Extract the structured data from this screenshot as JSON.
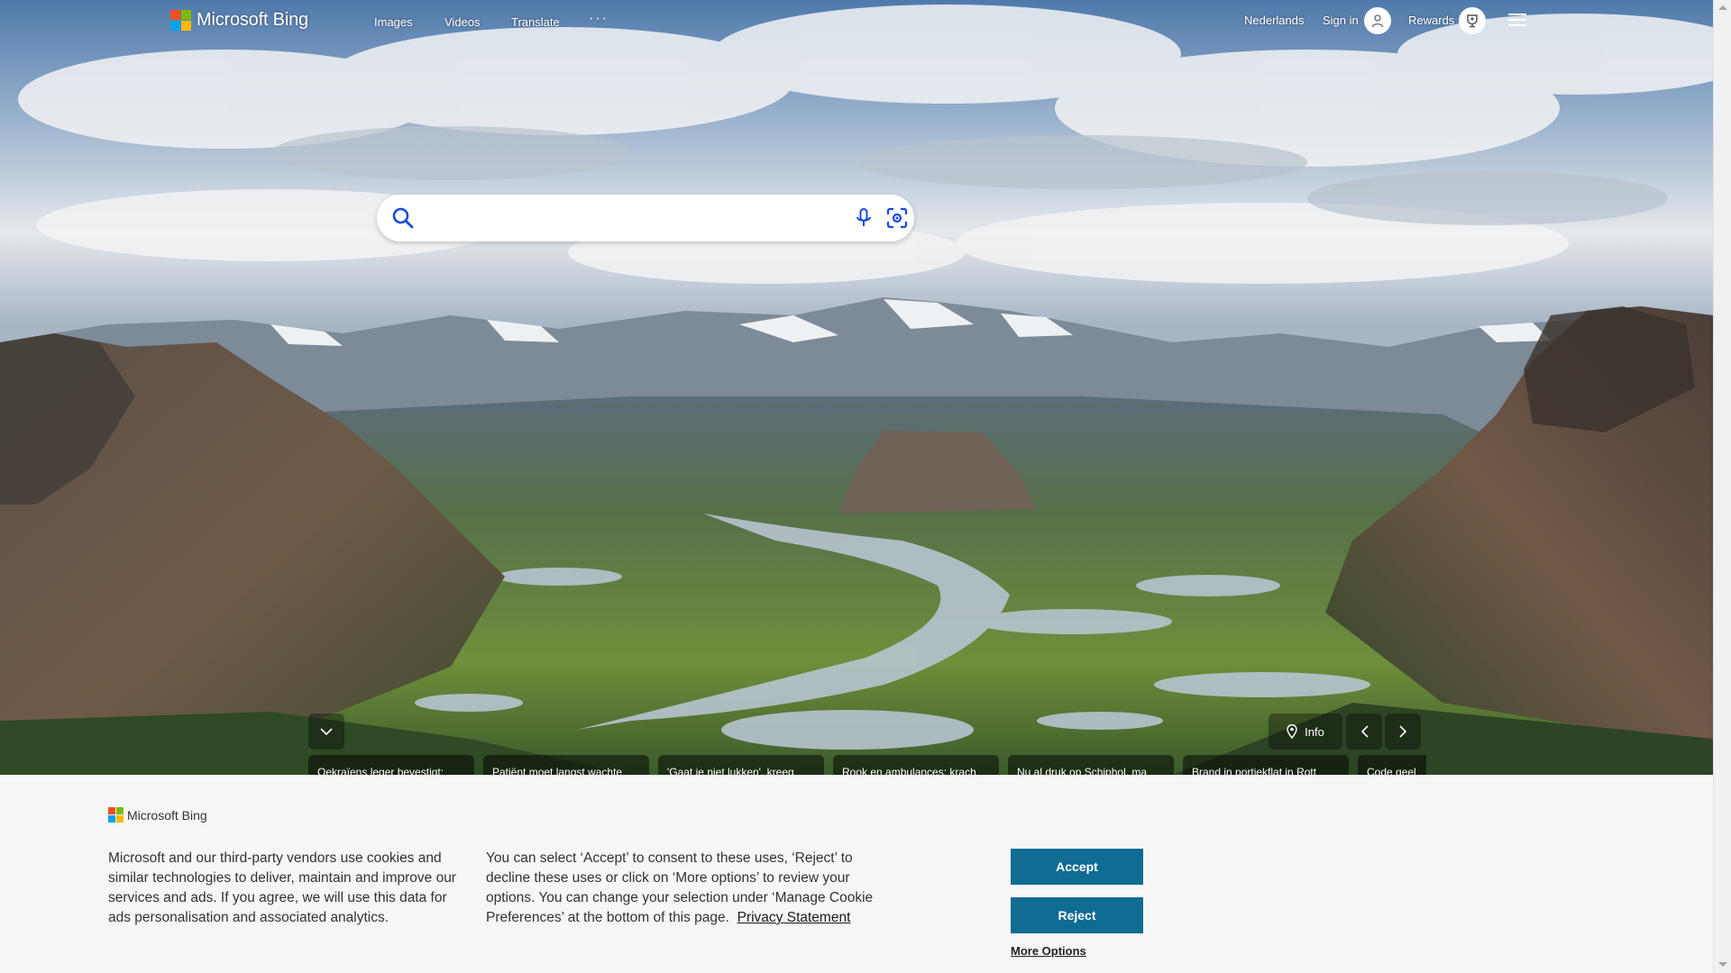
{
  "header": {
    "logo_text": "Microsoft Bing",
    "nav": [
      "Images",
      "Videos",
      "Translate"
    ],
    "more": "···",
    "language": "Nederlands",
    "sign_in": "Sign in",
    "rewards": "Rewards"
  },
  "search": {
    "placeholder": ""
  },
  "controls": {
    "info": "Info"
  },
  "news": [
    "Oekraïens leger bevestigt:",
    "Patiënt moet langst wachte",
    "'Gaat je niet lukken', kreeg",
    "Rook en ambulances: krach",
    "Nu al druk op Schiphol, ma",
    "Brand in portiekflat in Rott",
    "Code geel"
  ],
  "cookie": {
    "logo_text": "Microsoft Bing",
    "text1": "Microsoft and our third-party vendors use cookies and similar technologies to deliver, maintain and improve our services and ads. If you agree, we will use this data for ads personalisation and associated analytics.",
    "text2": "You can select ‘Accept’ to consent to these uses, ‘Reject’ to decline these uses or click on ‘More options’ to review your options. You can change your selection under ‘Manage Cookie Preferences’ at the bottom of this page.",
    "privacy": "Privacy Statement",
    "accept": "Accept",
    "reject": "Reject",
    "more_options": "More Options"
  },
  "colors": {
    "accent": "#0f6c93",
    "banner_bg": "#f6f6f6"
  }
}
